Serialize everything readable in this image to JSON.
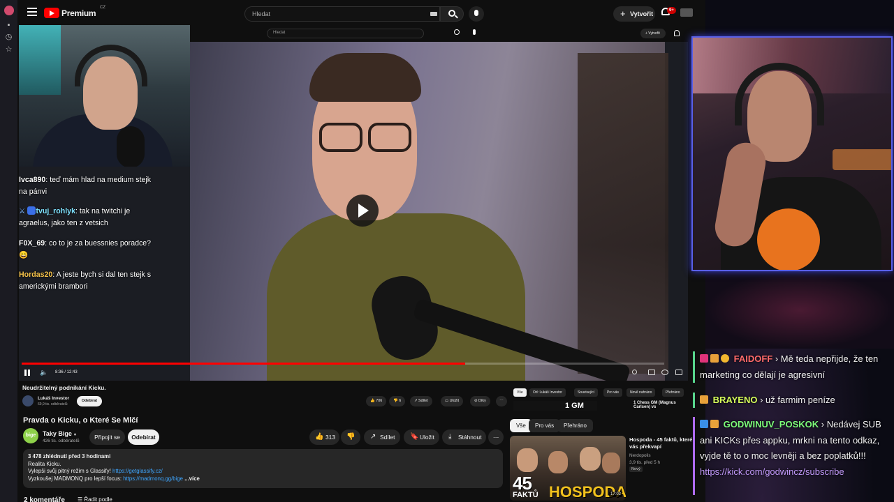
{
  "youtube": {
    "brand": "Premium",
    "region": "CZ",
    "search_placeholder": "Hledat",
    "create_label": "Vytvořit",
    "notification_count": "9+"
  },
  "inner_player": {
    "search_placeholder": "Hledat",
    "create_label": "+ Vytvořit",
    "time": "8:36 / 12:43",
    "progress": 0.69,
    "title": "Neudržitelný podnikání Kicku.",
    "channel": "Lukáš Investor",
    "subs": "69,9 tis. odběratelů",
    "subscribe": "Odebírat",
    "likes": "706",
    "dislikes": "6",
    "share": "Sdílet",
    "save": "Uložit",
    "thanks": "Díky",
    "chips": [
      "Vše",
      "Od: Lukáš Investor",
      "Související",
      "Pro vás",
      "Nově nahráno",
      "Přehráno"
    ],
    "rec_thumb_text": "1 GM",
    "rec_title": "1 Chess GM (Magnus Carlsen) vs"
  },
  "stream_chat_left": [
    {
      "user": "Ivca890",
      "color": "#ffffff",
      "text": "teď mám hlad na medium stejk na pánvi"
    },
    {
      "user": "tvuj_rohlyk",
      "color": "#7fe3ff",
      "text": "tak na twitchi je agraelus, jako ten z vetsich"
    },
    {
      "user": "F0X_69",
      "color": "#ffffff",
      "text": "co to je za buessnies poradce? 😄"
    },
    {
      "user": "Hordas20",
      "color": "#f5c24a",
      "text": "A jeste bych si dal ten stejk s americkými brambori"
    }
  ],
  "video": {
    "title": "Pravda o Kicku, o Které Se Mlčí",
    "channel": "Taky Bige",
    "channel_avatar": "bige",
    "subs": "426 tis. odběratelů",
    "join": "Připojit se",
    "subscribe": "Odebírat",
    "likes": "313",
    "share": "Sdílet",
    "save": "Uložit",
    "download": "Stáhnout",
    "desc_views": "3 478 zhlédnutí  před 3 hodinami",
    "desc_line1": "Realita Kicku.",
    "desc_line2_prefix": "Vylepši svůj pitný režim s Glassify! ",
    "desc_line2_link": "https://getglassify.cz/",
    "desc_line3_prefix": "Vyzkoušej MADMONQ pro lepší focus: ",
    "desc_line3_link": "https://madmonq.gg/bige",
    "desc_more": "...více",
    "comments": "2 komentáře",
    "sort": "Řadit podle"
  },
  "related": {
    "chips": [
      "Vše",
      "Pro vás",
      "Přehráno"
    ],
    "thumb_big": "45",
    "thumb_small": "FAKTŮ",
    "thumb_brand": "HOSPODA",
    "duration": "17:02",
    "title": "Hospoda - 45 faktů, které vás překvapí",
    "channel": "Nerdopolis",
    "meta": "3,9 tis.   před 5 h",
    "badge": "Nový"
  },
  "stream_chat_right": [
    {
      "user": "FAIDOFF",
      "color": "#ff6a6a",
      "bar": "#58d68d",
      "text": "Mě teda nepřijde, že ten marketing co dělají je agresivní"
    },
    {
      "user": "BRAYENO",
      "color": "#d6ff5a",
      "bar": "#58d68d",
      "text": "už farmim peníze"
    },
    {
      "user": "GODWINUV_POSKOK",
      "color": "#7dff7a",
      "bar": "#b06cff",
      "text": "Nedávej SUB ani KICKs přes appku, mrkni na tento odkaz, vyjde tě to o moc levněji a bez poplatků!!!",
      "link": "https://kick.com/godwincz/subscribe"
    }
  ]
}
